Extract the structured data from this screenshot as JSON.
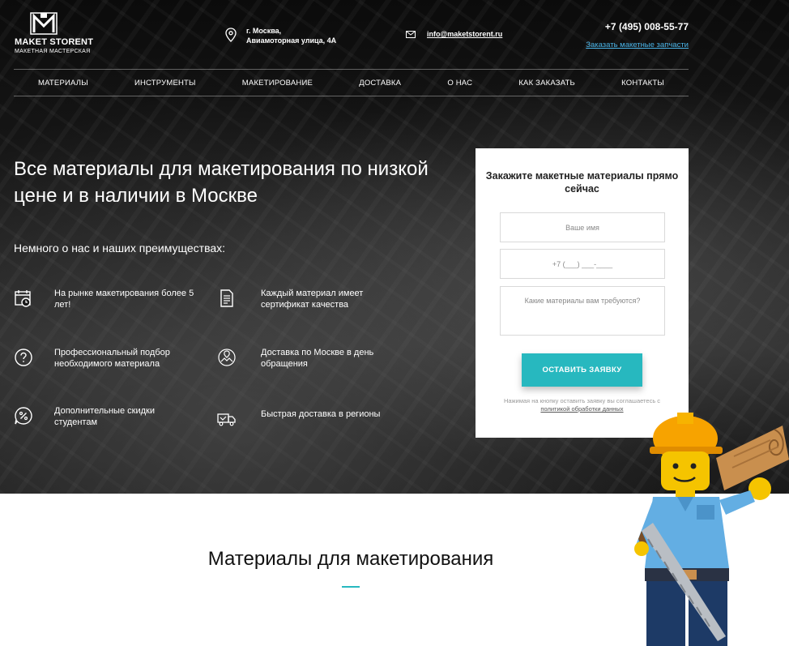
{
  "header": {
    "logo_name": "MAKET STORENT",
    "logo_sub": "МАКЕТНАЯ МАСТЕРСКАЯ",
    "address_line1": "г. Москва,",
    "address_line2": "Авиамоторная улица, 4А",
    "email": "info@maketstorent.ru",
    "phone": "+7 (495) 008-55-77",
    "order_link": "Заказать макетные запчасти"
  },
  "nav": [
    "МАТЕРИАЛЫ",
    "ИНСТРУМЕНТЫ",
    "МАКЕТИРОВАНИЕ",
    "ДОСТАВКА",
    "О НАС",
    "КАК ЗАКАЗАТЬ",
    "КОНТАКТЫ"
  ],
  "hero": {
    "headline": "Все материалы для макетирования по низкой цене и в наличии в Москве",
    "subhead": "Немного о нас и наших преимуществах:",
    "features": [
      {
        "icon": "calendar-clock-icon",
        "text": "На рынке макетирования более 5 лет!"
      },
      {
        "icon": "document-icon",
        "text": "Каждый материал имеет сертификат качества"
      },
      {
        "icon": "question-circle-icon",
        "text": "Профессиональный подбор необходимого материала"
      },
      {
        "icon": "map-pin-network-icon",
        "text": "Доставка по Москве в день обращения"
      },
      {
        "icon": "discount-badge-icon",
        "text": "Дополнительные скидки студентам"
      },
      {
        "icon": "truck-icon",
        "text": "Быстрая доставка в регионы"
      }
    ]
  },
  "form": {
    "title": "Закажите макетные материалы прямо сейчас",
    "name_placeholder": "Ваше имя",
    "phone_placeholder": "+7 (___) ___-____",
    "materials_placeholder": "Какие материалы вам требуются?",
    "submit_label": "ОСТАВИТЬ ЗАЯВКУ",
    "consent_text": "Нажимая на кнопку оставить заявку вы соглашаетесь с",
    "consent_link": "политикой обработки данных"
  },
  "section": {
    "title": "Материалы для макетирования"
  },
  "colors": {
    "accent": "#27b8bf",
    "link": "#4ab4e8"
  }
}
